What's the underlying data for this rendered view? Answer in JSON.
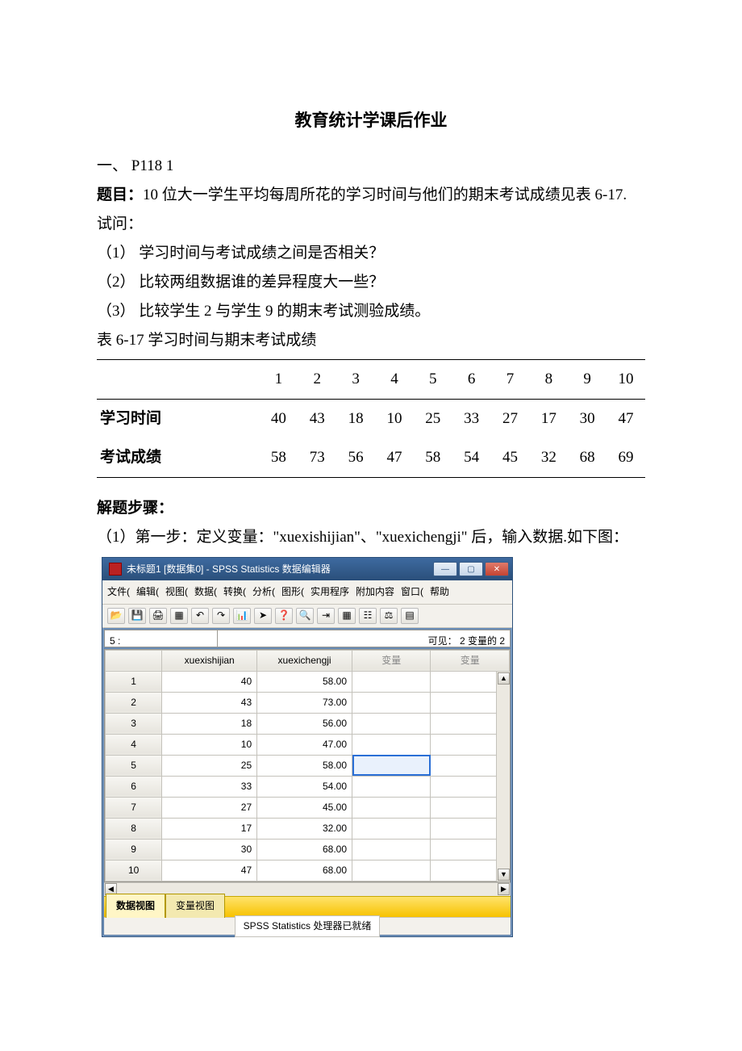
{
  "doc": {
    "title": "教育统计学课后作业",
    "section": "一、   P118   1",
    "question_label": "题目：",
    "question_text": "10 位大一学生平均每周所花的学习时间与他们的期末考试成绩见表 6-17. ",
    "ask": "试问：",
    "q1": "（1） 学习时间与考试成绩之间是否相关？",
    "q2": "（2） 比较两组数据谁的差异程度大一些？",
    "q3": "（3） 比较学生 2 与学生 9 的期末考试测验成绩。",
    "table_caption": "表 6-17   学习时间与期末考试成绩",
    "row1_label": "学习时间",
    "row2_label": "考试成绩",
    "cols": [
      "1",
      "2",
      "3",
      "4",
      "5",
      "6",
      "7",
      "8",
      "9",
      "10"
    ],
    "study_time": [
      "40",
      "43",
      "18",
      "10",
      "25",
      "33",
      "27",
      "17",
      "30",
      "47"
    ],
    "exam_score": [
      "58",
      "73",
      "56",
      "47",
      "58",
      "54",
      "45",
      "32",
      "68",
      "69"
    ],
    "steps_label": "解题步骤：",
    "step1": "（1）第一步：定义变量：\"xuexishijian\"、\"xuexichengji\" 后，输入数据.如下图："
  },
  "spss": {
    "window_title": "未标题1 [数据集0] - SPSS Statistics 数据编辑器",
    "menu": [
      "文件(",
      "编辑(",
      "视图(",
      "数据(",
      "转换(",
      "分析(",
      "图形(",
      "实用程序",
      "附加内容",
      "窗口(",
      "帮助"
    ],
    "toolbar_icons": [
      "open-icon",
      "save-icon",
      "print-icon",
      "db-icon",
      "undo-icon",
      "redo-icon",
      "chart-icon",
      "goto-icon",
      "info-icon",
      "find-icon",
      "insert-icon",
      "vars-icon",
      "value-icon",
      "weight-icon",
      "select-icon"
    ],
    "toolbar_glyphs": [
      "📂",
      "💾",
      "🖨",
      "▦",
      "↶",
      "↷",
      "📊",
      "➤",
      "❓",
      "🔍",
      "⇥",
      "▦",
      "☷",
      "⚖",
      "▤"
    ],
    "name_box": "5 :",
    "visible_label": "可见：  2 变量的 2",
    "columns": [
      "xuexishijian",
      "xuexichengji",
      "变量",
      "变量"
    ],
    "rows": [
      {
        "n": "1",
        "a": "40",
        "b": "58.00"
      },
      {
        "n": "2",
        "a": "43",
        "b": "73.00"
      },
      {
        "n": "3",
        "a": "18",
        "b": "56.00"
      },
      {
        "n": "4",
        "a": "10",
        "b": "47.00"
      },
      {
        "n": "5",
        "a": "25",
        "b": "58.00"
      },
      {
        "n": "6",
        "a": "33",
        "b": "54.00"
      },
      {
        "n": "7",
        "a": "27",
        "b": "45.00"
      },
      {
        "n": "8",
        "a": "17",
        "b": "32.00"
      },
      {
        "n": "9",
        "a": "30",
        "b": "68.00"
      },
      {
        "n": "10",
        "a": "47",
        "b": "68.00"
      }
    ],
    "selected_cell": {
      "row": 5,
      "col": 3
    },
    "tabs": {
      "active": "数据视图",
      "inactive": "变量视图"
    },
    "status": "SPSS Statistics  处理器已就绪"
  },
  "chart_data": {
    "type": "table",
    "title": "表 6-17 学习时间与期末考试成绩",
    "categories": [
      "1",
      "2",
      "3",
      "4",
      "5",
      "6",
      "7",
      "8",
      "9",
      "10"
    ],
    "series": [
      {
        "name": "学习时间",
        "values": [
          40,
          43,
          18,
          10,
          25,
          33,
          27,
          17,
          30,
          47
        ]
      },
      {
        "name": "考试成绩",
        "values": [
          58,
          73,
          56,
          47,
          58,
          54,
          45,
          32,
          68,
          69
        ]
      }
    ]
  }
}
